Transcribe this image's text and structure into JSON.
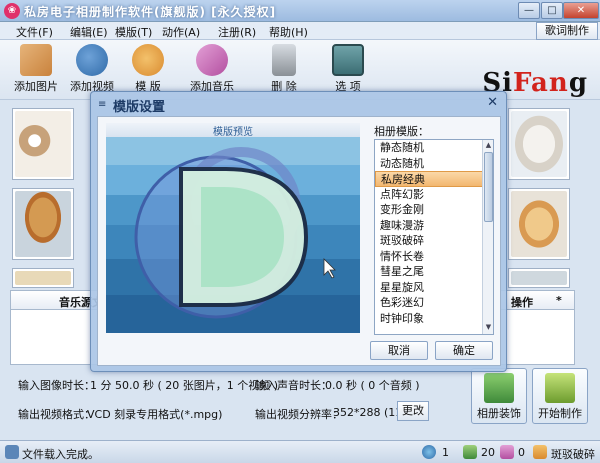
{
  "window": {
    "title": "私房电子相册制作软件(旗舰版) [永久授权]",
    "minimize": "—",
    "maximize": "□",
    "close": "✕"
  },
  "menu": [
    "文件(F)",
    "编辑(E)",
    "模版(T)",
    "动作(A)",
    "注册(R)",
    "帮助(H)"
  ],
  "lyric_button": "歌词制作",
  "toolbar": [
    {
      "label": "添加图片",
      "icon": "add-image-icon",
      "color": "#c9823c"
    },
    {
      "label": "添加视频",
      "icon": "add-video-icon",
      "color": "#2f6aa8"
    },
    {
      "label": "模 版",
      "icon": "palette-icon",
      "color": "#d98a2f"
    },
    {
      "label": "添加音乐",
      "icon": "add-music-icon",
      "color": "#b34fa0"
    },
    {
      "label": "删 除",
      "icon": "trash-icon",
      "color": "#8a9096"
    },
    {
      "label": "选 项",
      "icon": "options-icon",
      "color": "#3c6e74"
    }
  ],
  "logo": {
    "prefix": "Si",
    "accent": "Fan",
    "suffix": "g"
  },
  "music_table": {
    "col1": "音乐源文",
    "col2": "操作",
    "col3": "*"
  },
  "info": {
    "image_duration_label": "输入图像时长：",
    "image_duration_value": "1 分 50.0 秒 ( 20 张图片，1 个视频 )",
    "audio_duration_label": "输入声音时长：",
    "audio_duration_value": "0.0 秒 ( 0 个音频 )",
    "output_format_label": "输出视频格式：",
    "output_format_value": "VCD 刻录专用格式(*.mpg)",
    "output_res_label": "输出视频分辨率：",
    "output_res_value": "352*288 (11:9)",
    "change_button": "更改"
  },
  "big_buttons": [
    {
      "label": "相册装饰",
      "icon": "album-decor-icon",
      "color": "#3f8a3a"
    },
    {
      "label": "开始制作",
      "icon": "start-make-icon",
      "color": "#6d9c2e"
    }
  ],
  "status": {
    "message": "文件载入完成。",
    "count1": "1",
    "count2": "20",
    "count3": "0",
    "template_name": "斑驳破碎"
  },
  "dialog": {
    "title": "模版设置",
    "close": "✕",
    "preview_title": "模版预览",
    "template_label": "相册模版：",
    "templates": [
      "静态随机",
      "动态随机",
      "私房经典",
      "点阵幻影",
      "变形金刚",
      "趣味漫游",
      "斑驳破碎",
      "情怀长卷",
      "彗星之尾",
      "星星旋风",
      "色彩迷幻",
      "时钟印象"
    ],
    "selected_index": 2,
    "cancel_button": "取消",
    "ok_button": "确定"
  },
  "colors": {
    "accent": "#d2231c",
    "selected_item": "#f2b770",
    "dialog_frame": "#aac6e6"
  }
}
